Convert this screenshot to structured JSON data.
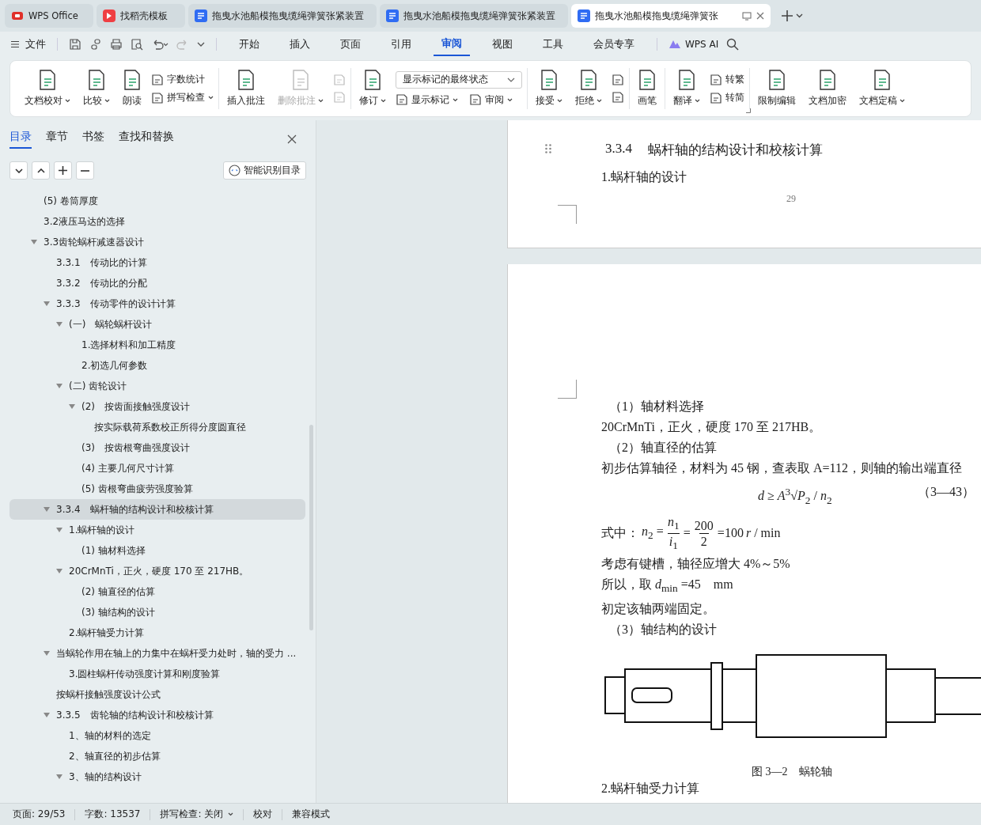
{
  "browser_tabs": [
    {
      "kind": "home",
      "title": "WPS Office",
      "selected": false
    },
    {
      "kind": "template",
      "title": "找稻壳模板",
      "selected": false
    },
    {
      "kind": "doc",
      "title": "拖曳水池船模拖曳缆绳弹簧张紧装置",
      "selected": false
    },
    {
      "kind": "doc",
      "title": "拖曳水池船模拖曳缆绳弹簧张紧装置",
      "selected": false
    },
    {
      "kind": "doc",
      "title": "拖曳水池船模拖曳缆绳弹簧张",
      "selected": true
    }
  ],
  "file_menu": "文件",
  "menu_tabs": [
    {
      "label": "开始",
      "selected": false
    },
    {
      "label": "插入",
      "selected": false
    },
    {
      "label": "页面",
      "selected": false
    },
    {
      "label": "引用",
      "selected": false
    },
    {
      "label": "审阅",
      "selected": true
    },
    {
      "label": "视图",
      "selected": false
    },
    {
      "label": "工具",
      "selected": false
    },
    {
      "label": "会员专享",
      "selected": false
    }
  ],
  "ai_button": "WPS AI",
  "ribbon": [
    {
      "items": [
        {
          "kind": "big",
          "label": "文档校对",
          "dropdown": true,
          "disabled": false
        },
        {
          "kind": "big",
          "label": "比较",
          "dropdown": true,
          "disabled": false
        },
        {
          "kind": "big",
          "label": "朗读",
          "dropdown": false,
          "disabled": false
        },
        {
          "kind": "stack",
          "rows": [
            {
              "label": "字数统计",
              "dropdown": false,
              "disabled": false
            },
            {
              "label": "拼写检查",
              "dropdown": true,
              "disabled": false
            }
          ]
        }
      ]
    },
    {
      "items": [
        {
          "kind": "big",
          "label": "插入批注",
          "dropdown": false,
          "disabled": false
        },
        {
          "kind": "big",
          "label": "删除批注",
          "dropdown": true,
          "disabled": true
        },
        {
          "kind": "stack",
          "rows": [
            {
              "disabled": true
            },
            {
              "disabled": true
            }
          ]
        }
      ]
    },
    {
      "items": [
        {
          "kind": "big",
          "label": "修订",
          "dropdown": true,
          "disabled": false
        },
        {
          "kind": "select",
          "value": "显示标记的最终状态",
          "rows": [
            {
              "label": "显示标记",
              "dropdown": true,
              "disabled": false
            },
            {
              "label": "审阅",
              "dropdown": true,
              "disabled": false
            }
          ]
        }
      ]
    },
    {
      "items": [
        {
          "kind": "big",
          "label": "接受",
          "dropdown": true,
          "disabled": false
        },
        {
          "kind": "big",
          "label": "拒绝",
          "dropdown": true,
          "disabled": false
        },
        {
          "kind": "stack",
          "rows": [
            {
              "disabled": false
            },
            {
              "disabled": false
            }
          ]
        }
      ]
    },
    {
      "items": [
        {
          "kind": "big",
          "label": "画笔",
          "dropdown": false,
          "disabled": false
        }
      ]
    },
    {
      "launcher": true,
      "items": [
        {
          "kind": "big",
          "label": "翻译",
          "dropdown": true,
          "disabled": false
        },
        {
          "kind": "stack",
          "rows": [
            {
              "label": "转繁",
              "dropdown": false,
              "disabled": false
            },
            {
              "label": "转简",
              "dropdown": false,
              "disabled": false
            }
          ]
        }
      ]
    },
    {
      "items": [
        {
          "kind": "big",
          "label": "限制编辑",
          "dropdown": false,
          "disabled": false
        },
        {
          "kind": "big",
          "label": "文档加密",
          "dropdown": false,
          "disabled": false
        },
        {
          "kind": "big",
          "label": "文档定稿",
          "dropdown": true,
          "disabled": false
        }
      ]
    }
  ],
  "nav_panel": {
    "tabs": [
      {
        "label": "目录",
        "selected": true
      },
      {
        "label": "章节",
        "selected": false
      },
      {
        "label": "书签",
        "selected": false
      },
      {
        "label": "查找和替换",
        "selected": false
      }
    ],
    "smart_toc_button": "智能识别目录",
    "toc": [
      {
        "label": "(5) 卷筒厚度",
        "selected": false
      },
      {
        "label": "3.2液压马达的选择",
        "selected": false
      },
      {
        "label": "3.3齿轮蜗杆减速器设计",
        "selected": false,
        "expanded": true,
        "children": [
          {
            "label": "3.3.1　传动比的计算",
            "selected": false
          },
          {
            "label": "3.3.2　传动比的分配",
            "selected": false
          },
          {
            "label": "3.3.3　传动零件的设计计算",
            "selected": false,
            "expanded": true,
            "children": [
              {
                "label": "(一)　蜗轮蜗杆设计",
                "selected": false,
                "expanded": true,
                "children": [
                  {
                    "label": "1.选择材料和加工精度",
                    "selected": false
                  },
                  {
                    "label": "2.初选几何参数",
                    "selected": false
                  }
                ]
              },
              {
                "label": "(二) 齿轮设计",
                "selected": false,
                "expanded": true,
                "children": [
                  {
                    "label": "(2)　按齿面接触强度设计",
                    "selected": false,
                    "expanded": true,
                    "children": [
                      {
                        "label": "按实际载荷系数校正所得分度圆直径",
                        "selected": false
                      }
                    ]
                  },
                  {
                    "label": "(3)　按齿根弯曲强度设计",
                    "selected": false
                  },
                  {
                    "label": "(4) 主要几何尺寸计算",
                    "selected": false
                  },
                  {
                    "label": "(5) 齿根弯曲疲劳强度验算",
                    "selected": false
                  }
                ]
              }
            ]
          },
          {
            "label": "3.3.4　蜗杆轴的结构设计和校核计算",
            "selected": true,
            "expanded": true,
            "children": [
              {
                "label": "1.蜗杆轴的设计",
                "selected": false,
                "expanded": true,
                "children": [
                  {
                    "label": "(1) 轴材料选择",
                    "selected": false
                  }
                ]
              },
              {
                "label": "20CrMnTi，正火，硬度 170 至 217HB。",
                "selected": false,
                "expanded": true,
                "children": [
                  {
                    "label": "(2) 轴直径的估算",
                    "selected": false
                  },
                  {
                    "label": "(3) 轴结构的设计",
                    "selected": false
                  }
                ]
              },
              {
                "label": "2.蜗杆轴受力计算",
                "selected": false
              }
            ]
          },
          {
            "label": "当蜗轮作用在轴上的力集中在蜗杆受力处时，轴的受力 ...",
            "selected": false,
            "expanded": true,
            "children": [
              {
                "label": "3.圆柱蜗杆传动强度计算和刚度验算",
                "selected": false
              }
            ]
          },
          {
            "label": "按蜗杆接触强度设计公式",
            "selected": false
          },
          {
            "label": "3.3.5　齿轮轴的结构设计和校核计算",
            "selected": false,
            "expanded": true,
            "children": [
              {
                "label": "1、轴的材料的选定",
                "selected": false
              },
              {
                "label": "2、轴直径的初步估算",
                "selected": false
              },
              {
                "label": "3、轴的结构设计",
                "selected": false,
                "expanded": true
              }
            ]
          }
        ]
      }
    ]
  },
  "document": {
    "page1": {
      "heading_number": "3.3.4",
      "heading_title": "蜗杆轴的结构设计和校核计算",
      "paragraph": "1.蜗杆轴的设计",
      "page_number": "29"
    },
    "page2": {
      "blocks": [
        {
          "kind": "subhead",
          "text": "（1）轴材料选择"
        },
        {
          "kind": "para",
          "text": "20CrMnTi，正火，硬度 170 至 217HB。"
        },
        {
          "kind": "subhead",
          "text": "（2）轴直径的估算"
        },
        {
          "kind": "para",
          "text": "初步估算轴径，材料为 45 钢，查表取 A=112，则轴的输出端直径"
        },
        {
          "kind": "equation",
          "text": "*d* ≥ *A*$^{3}$√*P*$_{2}$ / *n*$_{2}$",
          "number": "（3—43）"
        },
        {
          "kind": "fraction_line",
          "parts": [
            {
              "kind": "text",
              "text": "式中："
            },
            {
              "kind": "math",
              "text": "*n*$_{2}$ ="
            },
            {
              "kind": "fraction",
              "numerator": "*n*$_{1}$",
              "denominator": "*i*$_{1}$"
            },
            {
              "kind": "math",
              "text": "="
            },
            {
              "kind": "fraction",
              "numerator": "200",
              "denominator": "2"
            },
            {
              "kind": "math",
              "text": "=100"
            },
            {
              "kind": "math",
              "text": "*r* / min"
            }
          ]
        },
        {
          "kind": "para",
          "text": "考虑有键槽，轴径应增大 4%～5%"
        },
        {
          "kind": "para",
          "text": "所以，取 *d*$_{min}$ =45　mm"
        },
        {
          "kind": "para",
          "text": "初定该轴两端固定。"
        },
        {
          "kind": "subhead",
          "text": "（3）轴结构的设计"
        }
      ],
      "figure_caption": "图 3—2　蜗轮轴",
      "next_paragraph": "2.蜗杆轴受力计算"
    }
  },
  "status_bar": [
    {
      "kind": "text",
      "text": "页面: 29/53"
    },
    {
      "kind": "text",
      "text": "字数: 13537"
    },
    {
      "kind": "dropdown",
      "text": "拼写检查: 关闭"
    },
    {
      "kind": "text",
      "text": "校对"
    },
    {
      "kind": "text",
      "text": "兼容模式"
    }
  ]
}
